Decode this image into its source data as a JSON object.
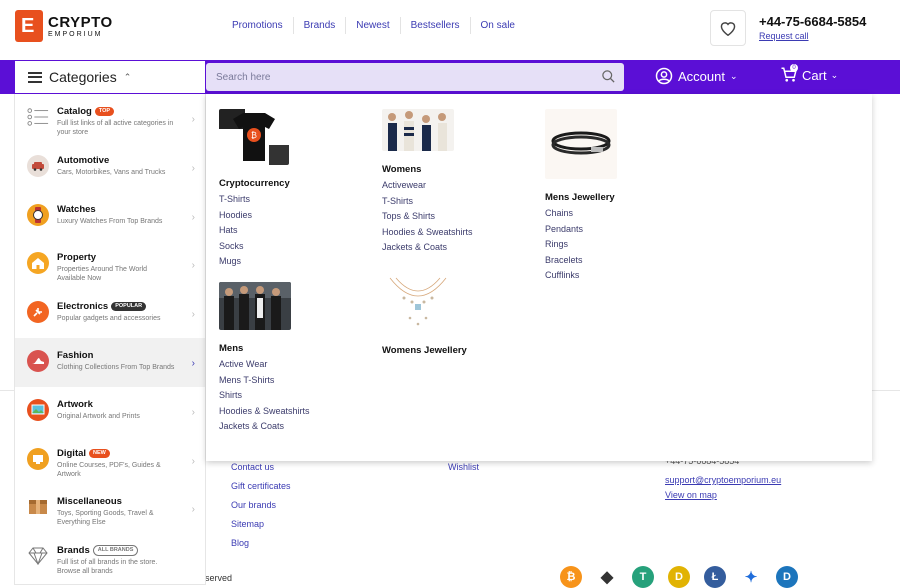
{
  "logo": {
    "letter": "E",
    "line1": "CRYPTO",
    "line2": "EMPORIUM"
  },
  "top_nav": [
    "Promotions",
    "Brands",
    "Newest",
    "Bestsellers",
    "On sale"
  ],
  "contact": {
    "phone": "+44-75-6684-5854",
    "request": "Request call"
  },
  "menu_bar": {
    "categories_label": "Categories",
    "search_placeholder": "Search here",
    "account_label": "Account",
    "cart_label": "Cart",
    "cart_count": "0"
  },
  "sidebar": [
    {
      "title": "Catalog",
      "tag": "TOP",
      "desc": "Full list links of all active categories in your store",
      "icon": "list-icon"
    },
    {
      "title": "Automotive",
      "tag": "",
      "desc": "Cars, Motorbikes, Vans and Trucks",
      "icon": "car-icon"
    },
    {
      "title": "Watches",
      "tag": "",
      "desc": "Luxury Watches From Top Brands",
      "icon": "watch-icon"
    },
    {
      "title": "Property",
      "tag": "",
      "desc": "Properties Around The World Available Now",
      "icon": "house-icon"
    },
    {
      "title": "Electronics",
      "tag": "POPULAR",
      "desc": "Popular gadgets and accessories",
      "icon": "plug-icon"
    },
    {
      "title": "Fashion",
      "tag": "",
      "desc": "Clothing Collections From Top Brands",
      "icon": "shoe-icon"
    },
    {
      "title": "Artwork",
      "tag": "",
      "desc": "Original Artwork and Prints",
      "icon": "painting-icon"
    },
    {
      "title": "Digital",
      "tag": "NEW",
      "desc": "Online Courses, PDF's, Guides & Artwork",
      "icon": "digital-icon"
    },
    {
      "title": "Miscellaneous",
      "tag": "",
      "desc": "Toys, Sporting Goods, Travel & Everything Else",
      "icon": "box-icon"
    },
    {
      "title": "Brands",
      "tag": "ALL BRANDS",
      "desc": "Full list of all brands in the store. Browse all brands",
      "icon": "diamond-icon"
    }
  ],
  "mega_menu": {
    "cryptocurrency": {
      "heading": "Cryptocurrency",
      "links": [
        "T-Shirts",
        "Hoodies",
        "Hats",
        "Socks",
        "Mugs"
      ]
    },
    "womens": {
      "heading": "Womens",
      "links": [
        "Activewear",
        "T-Shirts",
        "Tops & Shirts",
        "Hoodies & Sweatshirts",
        "Jackets & Coats"
      ]
    },
    "mens_jewellery": {
      "heading": "Mens Jewellery",
      "links": [
        "Chains",
        "Pendants",
        "Rings",
        "Bracelets",
        "Cufflinks"
      ]
    },
    "mens": {
      "heading": "Mens",
      "links": [
        "Active Wear",
        "Mens T-Shirts",
        "Shirts",
        "Hoodies & Sweatshirts",
        "Jackets & Coats"
      ]
    },
    "womens_jewellery": {
      "heading": "Womens Jewellery"
    }
  },
  "footer": {
    "col1": [
      "Contact us",
      "Gift certificates",
      "Our brands",
      "Sitemap",
      "Blog"
    ],
    "col2": [
      "Wishlist"
    ],
    "col3": [
      "+44-75-6684-5854",
      "support@cryptoemporium.eu",
      "View on map"
    ],
    "served": "served"
  },
  "crypto_icons": [
    "bitcoin-icon",
    "ethereum-icon",
    "tether-icon",
    "dogecoin-icon",
    "litecoin-icon",
    "ripple-icon",
    "dash-icon"
  ],
  "colors": {
    "accent": "#5b0fd6",
    "brand": "#e8501e",
    "link": "#3b3bb3"
  }
}
